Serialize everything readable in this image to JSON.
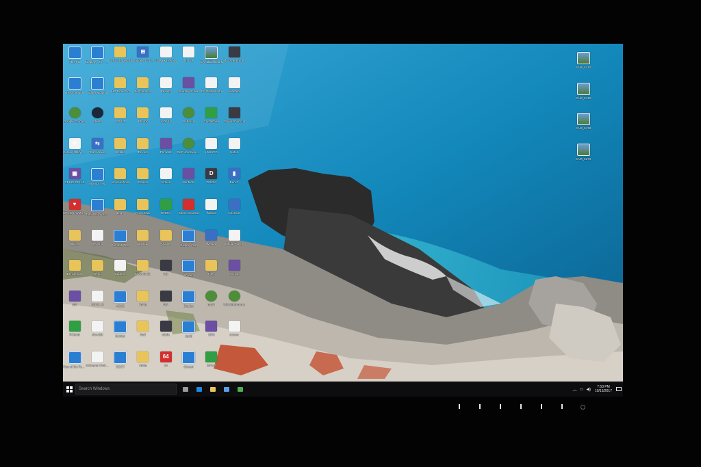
{
  "desktop": {
    "icons": [
      {
        "name": "this-pc-icon",
        "label": "This PC",
        "glyph": "monitor",
        "sym": "",
        "col": 0,
        "row": 0
      },
      {
        "name": "display-icon",
        "label": "Display - 2K - 144 Hz",
        "glyph": "monitor",
        "sym": "",
        "col": 1,
        "row": 0
      },
      {
        "name": "gpu-tool-icon",
        "label": "GPU-ShaderGL",
        "glyph": "folder",
        "sym": "",
        "col": 2,
        "row": 0
      },
      {
        "name": "windows-upgrade-icon",
        "label": "Windows 10 Upgrade",
        "glyph": "app",
        "sym": "⊞",
        "col": 3,
        "row": 0
      },
      {
        "name": "file-icon",
        "label": "3DMark Results",
        "glyph": "file",
        "sym": "",
        "col": 4,
        "row": 0
      },
      {
        "name": "ntlite-icon",
        "label": "NTLite",
        "glyph": "file",
        "sym": "",
        "col": 5,
        "row": 0
      },
      {
        "name": "crystaldisk-icon",
        "label": "CrystalDiskMark",
        "glyph": "photo",
        "sym": "",
        "col": 6,
        "row": 0
      },
      {
        "name": "ms-afterburner-icon",
        "label": "MSI Afterburner",
        "glyph": "dark",
        "sym": "",
        "col": 7,
        "row": 0
      },
      {
        "name": "recycle-bin-icon",
        "label": "Recycle Bin",
        "glyph": "monitor",
        "sym": "",
        "col": 0,
        "row": 1
      },
      {
        "name": "monitor-test-icon",
        "label": "Super Monitor",
        "glyph": "monitor",
        "sym": "",
        "col": 1,
        "row": 1
      },
      {
        "name": "folder-icon",
        "label": "HD Tune Pro",
        "glyph": "folder",
        "sym": "",
        "col": 2,
        "row": 1
      },
      {
        "name": "folder-icon",
        "label": "Benchmarks",
        "glyph": "folder",
        "sym": "",
        "col": 3,
        "row": 1
      },
      {
        "name": "file-icon",
        "label": "Results",
        "glyph": "file",
        "sym": "",
        "col": 4,
        "row": 1
      },
      {
        "name": "winrar-icon",
        "label": "Shadow of War",
        "glyph": "tile",
        "sym": "",
        "col": 5,
        "row": 1
      },
      {
        "name": "crystaldisk-icon",
        "label": "CrystalDiskInfo",
        "glyph": "file",
        "sym": "",
        "col": 6,
        "row": 1
      },
      {
        "name": "text-file-icon",
        "label": "readme",
        "glyph": "file",
        "sym": "",
        "col": 7,
        "row": 1
      },
      {
        "name": "chrome-icon",
        "label": "Google Chrome",
        "glyph": "round",
        "sym": "",
        "col": 0,
        "row": 2
      },
      {
        "name": "steam-icon",
        "label": "Steam",
        "glyph": "steam",
        "sym": "",
        "col": 1,
        "row": 2
      },
      {
        "name": "folder-icon",
        "label": "GPU-Z",
        "glyph": "folder",
        "sym": "",
        "col": 2,
        "row": 2
      },
      {
        "name": "folder-icon",
        "label": "Photos",
        "glyph": "folder",
        "sym": "",
        "col": 3,
        "row": 2
      },
      {
        "name": "file-icon",
        "label": "AIDA64",
        "glyph": "file",
        "sym": "",
        "col": 4,
        "row": 2
      },
      {
        "name": "gaming-app-icon",
        "label": "GeForce",
        "glyph": "round",
        "sym": "",
        "col": 5,
        "row": 2
      },
      {
        "name": "crystaldisk-icon",
        "label": "CrystalDisk",
        "glyph": "green",
        "sym": "",
        "col": 6,
        "row": 2
      },
      {
        "name": "origin-icon",
        "label": "Origin Shortcut",
        "glyph": "dark",
        "sym": "",
        "col": 7,
        "row": 2
      },
      {
        "name": "corsair-icon",
        "label": "Corsair Utility Engine",
        "glyph": "file",
        "sym": "✈",
        "col": 0,
        "row": 3
      },
      {
        "name": "teamviewer-icon",
        "label": "TeamViewer",
        "glyph": "app",
        "sym": "⇆",
        "col": 1,
        "row": 3
      },
      {
        "name": "folder-icon",
        "label": "Installs",
        "glyph": "folder",
        "sym": "",
        "col": 2,
        "row": 3
      },
      {
        "name": "folder-icon",
        "label": "Drivers",
        "glyph": "folder",
        "sym": "",
        "col": 3,
        "row": 3
      },
      {
        "name": "winrar-icon",
        "label": "Prime95",
        "glyph": "tile",
        "sym": "",
        "col": 4,
        "row": 3
      },
      {
        "name": "geforce-icon",
        "label": "GeForce Experience",
        "glyph": "round",
        "sym": "",
        "col": 5,
        "row": 3
      },
      {
        "name": "text-file-icon",
        "label": "HWiNFO",
        "glyph": "file",
        "sym": "",
        "col": 6,
        "row": 3
      },
      {
        "name": "text-file-icon",
        "label": "Notes",
        "glyph": "file",
        "sym": "",
        "col": 7,
        "row": 3
      },
      {
        "name": "cpuid-icon",
        "label": "CPUID CPU-Z",
        "glyph": "tile",
        "sym": "▦",
        "col": 0,
        "row": 4
      },
      {
        "name": "monitor-test-icon",
        "label": "Monitor Test",
        "glyph": "monitor",
        "sym": "",
        "col": 1,
        "row": 4
      },
      {
        "name": "folder-icon",
        "label": "Screenshots",
        "glyph": "folder",
        "sym": "",
        "col": 2,
        "row": 4
      },
      {
        "name": "folder-icon",
        "label": "Games",
        "glyph": "folder",
        "sym": "",
        "col": 3,
        "row": 4
      },
      {
        "name": "video-icon",
        "label": "Videos",
        "glyph": "file",
        "sym": "",
        "col": 4,
        "row": 4
      },
      {
        "name": "winrar-icon",
        "label": "WinRAR",
        "glyph": "tile",
        "sym": "",
        "col": 5,
        "row": 4
      },
      {
        "name": "doom-icon",
        "label": "DOOM",
        "glyph": "dark",
        "sym": "D",
        "col": 6,
        "row": 4
      },
      {
        "name": "bench-icon",
        "label": "Bench",
        "glyph": "app",
        "sym": "▮",
        "col": 7,
        "row": 4
      },
      {
        "name": "cpuid-hwmonitor-icon",
        "label": "CPUID HWMonitor",
        "glyph": "red",
        "sym": "♥",
        "col": 0,
        "row": 5
      },
      {
        "name": "total-war-icon",
        "label": "Total War WARHAMMER",
        "glyph": "monitor",
        "sym": "",
        "col": 1,
        "row": 5
      },
      {
        "name": "folder-icon",
        "label": "Logs",
        "glyph": "folder",
        "sym": "",
        "col": 2,
        "row": 5
      },
      {
        "name": "folder-icon",
        "label": "PowerMax",
        "glyph": "folder",
        "sym": "",
        "col": 3,
        "row": 5
      },
      {
        "name": "nvidia-icon",
        "label": "NVIDIA",
        "glyph": "green",
        "sym": "",
        "col": 4,
        "row": 5
      },
      {
        "name": "game-icon",
        "label": "Game Shortcut",
        "glyph": "red",
        "sym": "",
        "col": 5,
        "row": 5
      },
      {
        "name": "fallout-icon",
        "label": "fallout",
        "glyph": "file",
        "sym": "",
        "col": 6,
        "row": 5
      },
      {
        "name": "shortcut-icon",
        "label": "Shortcut",
        "glyph": "app",
        "sym": "",
        "col": 7,
        "row": 5
      },
      {
        "name": "app-icon",
        "label": "Utilities",
        "glyph": "folder",
        "sym": "",
        "col": 0,
        "row": 6
      },
      {
        "name": "file-icon",
        "label": "Reports",
        "glyph": "file",
        "sym": "",
        "col": 1,
        "row": 6
      },
      {
        "name": "monitor-test-icon",
        "label": "Prime95 Test",
        "glyph": "monitor",
        "sym": "",
        "col": 2,
        "row": 6
      },
      {
        "name": "folder-icon",
        "label": "Backup",
        "glyph": "folder",
        "sym": "",
        "col": 3,
        "row": 6
      },
      {
        "name": "folder-icon",
        "label": "Archive",
        "glyph": "folder",
        "sym": "",
        "col": 4,
        "row": 6
      },
      {
        "name": "monitor-test-icon",
        "label": "Display Test",
        "glyph": "monitor",
        "sym": "",
        "col": 5,
        "row": 6
      },
      {
        "name": "media-icon",
        "label": "Media",
        "glyph": "app",
        "sym": "",
        "col": 6,
        "row": 6
      },
      {
        "name": "media-icon",
        "label": "Media Player",
        "glyph": "file",
        "sym": "",
        "col": 7,
        "row": 6
      },
      {
        "name": "benchmark-icon",
        "label": "Benchmark",
        "glyph": "folder",
        "sym": "",
        "col": 0,
        "row": 7
      },
      {
        "name": "folder-icon",
        "label": "Temp",
        "glyph": "folder",
        "sym": "",
        "col": 1,
        "row": 7
      },
      {
        "name": "file-icon",
        "label": "Capture",
        "glyph": "file",
        "sym": "",
        "col": 2,
        "row": 7
      },
      {
        "name": "folder-icon",
        "label": "Downloads",
        "glyph": "folder",
        "sym": "",
        "col": 3,
        "row": 7
      },
      {
        "name": "dark-app-icon",
        "label": "App",
        "glyph": "dark",
        "sym": "",
        "col": 4,
        "row": 7
      },
      {
        "name": "monitor-test-icon",
        "label": "Screen",
        "glyph": "monitor",
        "sym": "",
        "col": 5,
        "row": 7
      },
      {
        "name": "folder-icon",
        "label": "Files",
        "glyph": "folder",
        "sym": "",
        "col": 6,
        "row": 7
      },
      {
        "name": "winrar-icon",
        "label": "Archive",
        "glyph": "tile",
        "sym": "",
        "col": 7,
        "row": 7
      },
      {
        "name": "pdf-icon",
        "label": "pdfo",
        "glyph": "tile",
        "sym": "",
        "col": 0,
        "row": 8
      },
      {
        "name": "asus-icon",
        "label": "ASUS_AI",
        "glyph": "file",
        "sym": "",
        "col": 1,
        "row": 8
      },
      {
        "name": "monitor-test-icon",
        "label": "ASUS",
        "glyph": "monitor",
        "sym": "",
        "col": 2,
        "row": 8
      },
      {
        "name": "folder-icon",
        "label": "Folder",
        "glyph": "folder",
        "sym": "",
        "col": 3,
        "row": 8
      },
      {
        "name": "dark-app-icon",
        "label": "DW",
        "glyph": "dark",
        "sym": "",
        "col": 4,
        "row": 8
      },
      {
        "name": "monitor-test-icon",
        "label": "Display",
        "glyph": "monitor",
        "sym": "",
        "col": 5,
        "row": 8
      },
      {
        "name": "geforce-icon",
        "label": "mraid",
        "glyph": "round",
        "sym": "",
        "col": 6,
        "row": 8
      },
      {
        "name": "msi-afterburner-icon",
        "label": "MSI Afterburner",
        "glyph": "round",
        "sym": "",
        "col": 7,
        "row": 8
      },
      {
        "name": "pcmark-icon",
        "label": "PCMark",
        "glyph": "green",
        "sym": "",
        "col": 0,
        "row": 9
      },
      {
        "name": "atto-icon",
        "label": "Atto-disk",
        "glyph": "file",
        "sym": "",
        "col": 1,
        "row": 9
      },
      {
        "name": "monitor-test-icon",
        "label": "Monitor",
        "glyph": "monitor",
        "sym": "",
        "col": 2,
        "row": 9
      },
      {
        "name": "stuff-folder-icon",
        "label": "Stuff",
        "glyph": "folder",
        "sym": "",
        "col": 3,
        "row": 9
      },
      {
        "name": "adobe-icon",
        "label": "adobe",
        "glyph": "dark",
        "sym": "",
        "col": 4,
        "row": 9
      },
      {
        "name": "monitor-test-icon",
        "label": "cpuid",
        "glyph": "monitor",
        "sym": "",
        "col": 5,
        "row": 9
      },
      {
        "name": "winrar-icon",
        "label": "GPU",
        "glyph": "tile",
        "sym": "",
        "col": 6,
        "row": 9
      },
      {
        "name": "text-file-icon",
        "label": "scores",
        "glyph": "file",
        "sym": "",
        "col": 7,
        "row": 9
      },
      {
        "name": "tomb-raider-icon",
        "label": "Rise of the Tomb Raider",
        "glyph": "monitor",
        "sym": "",
        "col": 0,
        "row": 10
      },
      {
        "name": "ccleaner-icon",
        "label": "CCleaner Professional",
        "glyph": "file",
        "sym": "",
        "col": 1,
        "row": 10
      },
      {
        "name": "monitor-test-icon",
        "label": "OCCT",
        "glyph": "monitor",
        "sym": "",
        "col": 2,
        "row": 10
      },
      {
        "name": "folder-icon",
        "label": "Folder",
        "glyph": "folder",
        "sym": "",
        "col": 3,
        "row": 10
      },
      {
        "name": "aida64-icon",
        "label": "64",
        "glyph": "red",
        "sym": "64",
        "col": 4,
        "row": 10
      },
      {
        "name": "monitor-test-icon",
        "label": "Screen",
        "glyph": "monitor",
        "sym": "",
        "col": 5,
        "row": 10
      },
      {
        "name": "gpu-z-icon",
        "label": "GPU-Z",
        "glyph": "green",
        "sym": "",
        "col": 6,
        "row": 10
      }
    ],
    "right_icons": [
      {
        "name": "photo-icon",
        "label": "SAM_5410",
        "row": 0
      },
      {
        "name": "photo-icon",
        "label": "SAM_5419",
        "row": 1
      },
      {
        "name": "photo-icon",
        "label": "SAM_5438",
        "row": 2
      },
      {
        "name": "photo-icon",
        "label": "SAM_5279",
        "row": 3
      }
    ]
  },
  "taskbar": {
    "search_placeholder": "Search Windows",
    "apps": [
      {
        "name": "task-view-icon",
        "color": "#9a9a9a"
      },
      {
        "name": "edge-icon",
        "color": "#1e88e5"
      },
      {
        "name": "file-explorer-icon",
        "color": "#e8c45a"
      },
      {
        "name": "store-icon",
        "color": "#5aa0e8"
      },
      {
        "name": "chrome-icon",
        "color": "#4caf50"
      }
    ],
    "clock_time": "7:53 PM",
    "clock_date": "10/15/2017"
  },
  "colors": {
    "sea": "#0c6fa0",
    "taskbar": "#0d0d0f",
    "folder": "#e8c45a"
  }
}
